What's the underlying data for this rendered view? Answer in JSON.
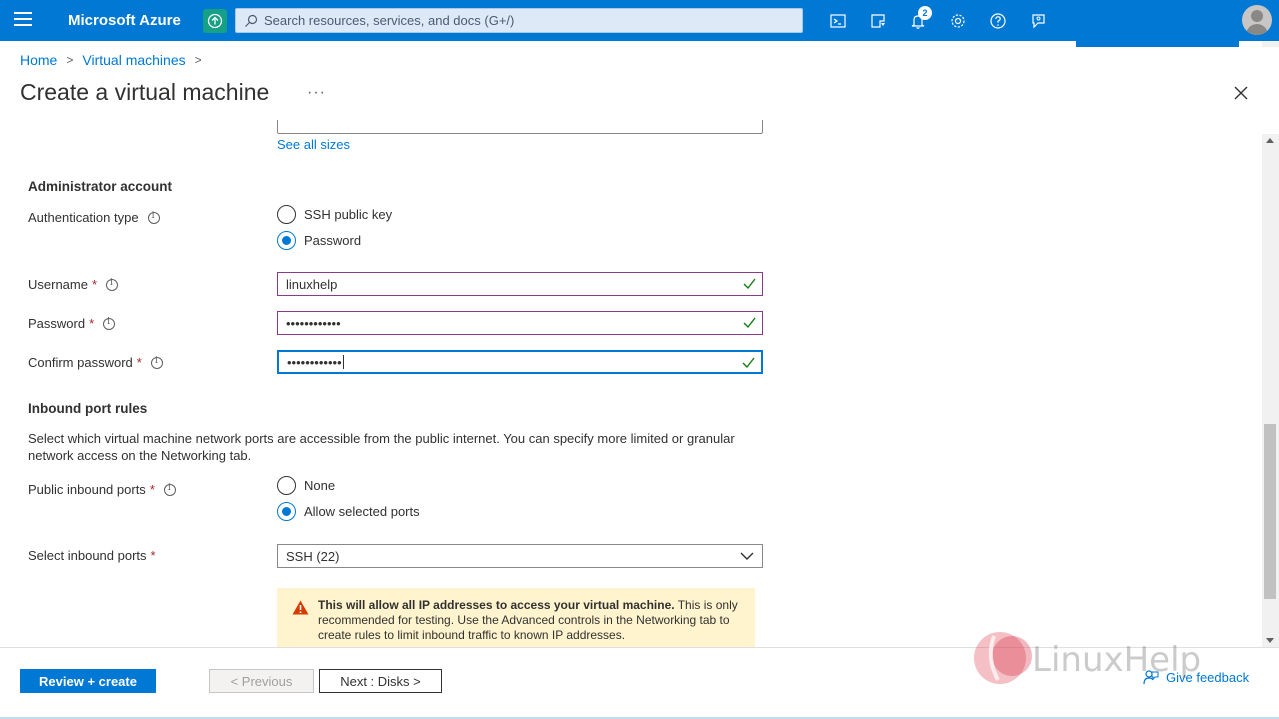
{
  "topbar": {
    "brand": "Microsoft Azure",
    "search_placeholder": "Search resources, services, and docs (G+/)",
    "notification_count": "2",
    "icons": [
      "menu-icon",
      "upgrade-icon",
      "search-icon",
      "cloud-shell-icon",
      "directory-filter-icon",
      "notification-icon",
      "settings-icon",
      "help-icon",
      "feedback-icon",
      "avatar"
    ]
  },
  "breadcrumb": {
    "items": [
      "Home",
      "Virtual machines"
    ]
  },
  "page": {
    "title": "Create a virtual machine",
    "more": "···"
  },
  "size": {
    "see_all_sizes": "See all sizes"
  },
  "admin": {
    "section_title": "Administrator account",
    "auth_type_label": "Authentication type",
    "auth_options": [
      "SSH public key",
      "Password"
    ],
    "auth_selected": "Password",
    "username_label": "Username",
    "username_value": "linuxhelp",
    "password_label": "Password",
    "password_value": "••••••••••••",
    "confirm_label": "Confirm password",
    "confirm_value": "••••••••••••",
    "required_mark": "*"
  },
  "inbound": {
    "section_title": "Inbound port rules",
    "description": "Select which virtual machine network ports are accessible from the public internet. You can specify more limited or granular network access on the Networking tab.",
    "public_ports_label": "Public inbound ports",
    "public_options": [
      "None",
      "Allow selected ports"
    ],
    "public_selected": "Allow selected ports",
    "select_ports_label": "Select inbound ports",
    "select_ports_value": "SSH (22)",
    "warning_bold": "This will allow all IP addresses to access your virtual machine.",
    "warning_text": " This is only recommended for testing.  Use the Advanced controls in the Networking tab to create rules to limit inbound traffic to known IP addresses."
  },
  "footer": {
    "review_create": "Review + create",
    "previous": "< Previous",
    "next": "Next : Disks >",
    "give_feedback": "Give feedback"
  },
  "watermark": {
    "text": "LinuxHelp"
  },
  "colors": {
    "azure_blue": "#0078d4",
    "valid_border": "#8b3a8b",
    "check_green": "#107c10",
    "warning_bg": "#fff4ce",
    "required_red": "#a4262c"
  }
}
